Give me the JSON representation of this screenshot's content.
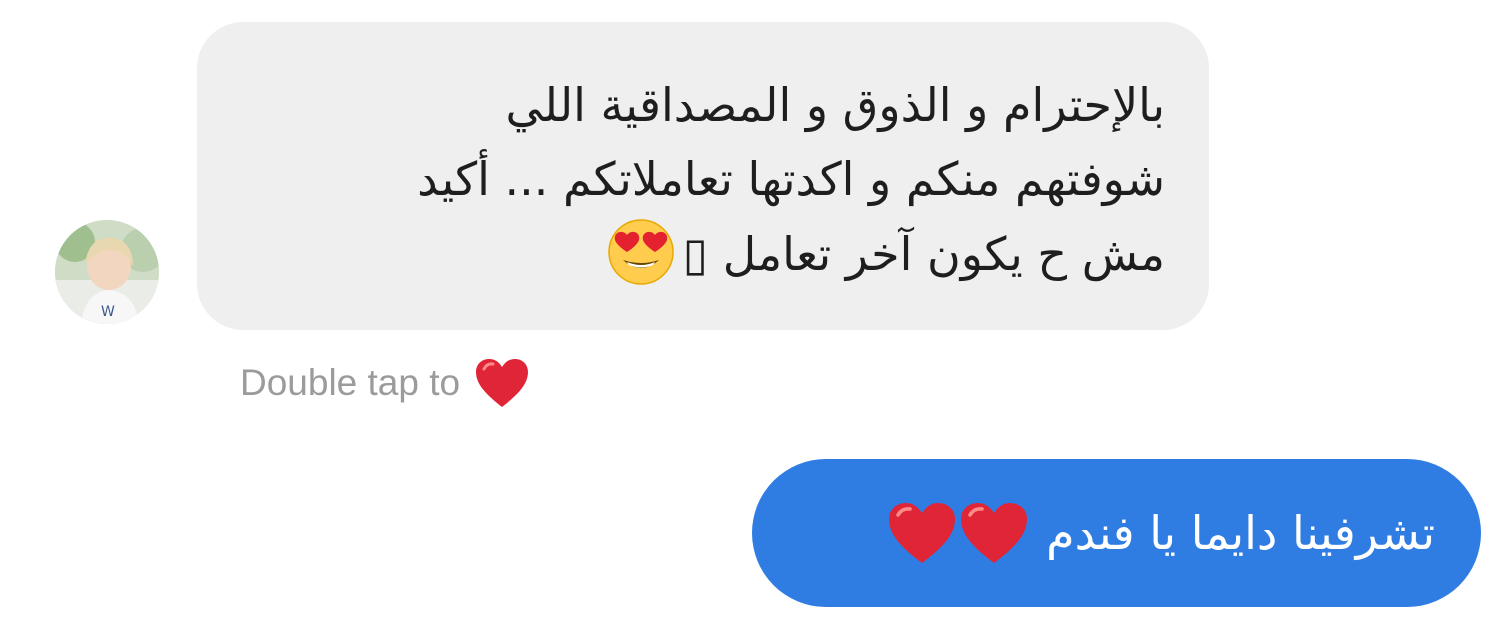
{
  "conversation": {
    "incoming": {
      "lines": [
        "بالإحترام و الذوق و المصداقية اللي",
        "شوفتهم منكم و اكدتها تعاملاتكم ... أكيد",
        "مش ح يكون آخر تعامل"
      ],
      "missing_glyph": "▯",
      "emoji": "heart-eyes-emoji",
      "bubble_color": "#efefef"
    },
    "reaction_hint": {
      "text": "Double tap to",
      "emoji": "red-heart-emoji"
    },
    "outgoing": {
      "text": "تشرفينا دايما يا فندم",
      "emojis": [
        "red-heart-emoji",
        "red-heart-emoji"
      ],
      "bubble_color": "#2f7ce3"
    }
  },
  "avatar": {
    "icon": "profile-photo"
  }
}
